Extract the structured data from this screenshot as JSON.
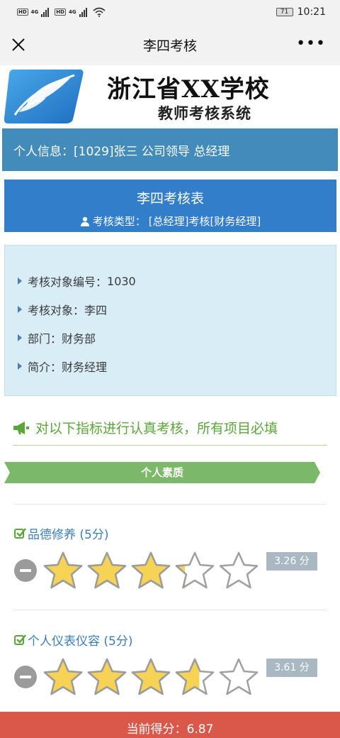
{
  "status_bar": {
    "sim1_labels": [
      "HD",
      "4G"
    ],
    "sim2_labels": [
      "HD",
      "4G"
    ],
    "battery": "71",
    "time": "10:21"
  },
  "titlebar": {
    "title": "李四考核",
    "more_label": "•••"
  },
  "banner": {
    "school_name": "浙江省XX学校",
    "system_name": "教师考核系统"
  },
  "user_info": {
    "label": "个人信息：",
    "value": "[1029]张三 公司领导 总经理"
  },
  "card": {
    "title": "李四考核表",
    "type_label": "考核类型：",
    "type_value": "[总经理]考核[财务经理]"
  },
  "info": {
    "rows": [
      {
        "label": "考核对象编号：",
        "value": "1030"
      },
      {
        "label": "考核对象：",
        "value": "李四"
      },
      {
        "label": "部门：",
        "value": "财务部"
      },
      {
        "label": "简介：",
        "value": "财务经理"
      }
    ]
  },
  "notice": "对以下指标进行认真考核，所有项目必填",
  "section": {
    "title": "个人素质"
  },
  "items": [
    {
      "label": "品德修养 (5分)",
      "rating": 3.26,
      "max": 5,
      "score_text": "3.26 分"
    },
    {
      "label": "个人仪表仪容 (5分)",
      "rating": 3.61,
      "max": 5,
      "score_text": "3.61 分"
    }
  ],
  "footer": {
    "label": "当前得分：",
    "value": "6.87"
  },
  "colors": {
    "header_blue": "#337ecb",
    "userinfo_blue": "#428bba",
    "info_bg": "#d9edf7",
    "notice_green": "#5aa63a",
    "ribbon_green": "#7cb86a",
    "star_fill": "#f6d355",
    "footer_red": "#d9584a"
  }
}
